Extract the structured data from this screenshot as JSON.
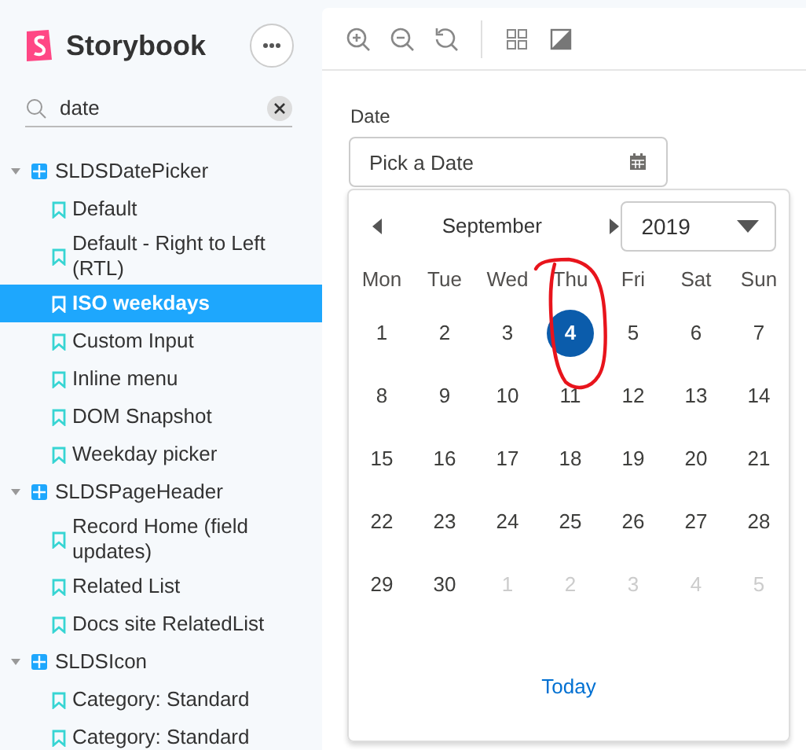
{
  "sidebar": {
    "brand": "Storybook",
    "search": {
      "value": "date"
    },
    "tree": [
      {
        "label": "SLDSDatePicker",
        "expanded": true,
        "children": [
          {
            "label": "Default",
            "selected": false
          },
          {
            "label": "Default - Right to Left (RTL)",
            "selected": false
          },
          {
            "label": "ISO weekdays",
            "selected": true
          },
          {
            "label": "Custom Input",
            "selected": false
          },
          {
            "label": "Inline menu",
            "selected": false
          },
          {
            "label": "DOM Snapshot",
            "selected": false
          },
          {
            "label": "Weekday picker",
            "selected": false
          }
        ]
      },
      {
        "label": "SLDSPageHeader",
        "expanded": true,
        "children": [
          {
            "label": "Record Home (field updates)",
            "selected": false
          },
          {
            "label": "Related List",
            "selected": false
          },
          {
            "label": "Docs site RelatedList",
            "selected": false
          }
        ]
      },
      {
        "label": "SLDSIcon",
        "expanded": true,
        "children": [
          {
            "label": "Category: Standard",
            "selected": false
          },
          {
            "label": "Category: Standard",
            "selected": false
          }
        ]
      }
    ]
  },
  "preview": {
    "field_label": "Date",
    "placeholder": "Pick a Date",
    "calendar": {
      "month": "September",
      "year": "2019",
      "weekdays": [
        "Mon",
        "Tue",
        "Wed",
        "Thu",
        "Fri",
        "Sat",
        "Sun"
      ],
      "weeks": [
        [
          {
            "label": "1",
            "selected": false,
            "outside": false
          },
          {
            "label": "2",
            "selected": false,
            "outside": false
          },
          {
            "label": "3",
            "selected": false,
            "outside": false
          },
          {
            "label": "4",
            "selected": true,
            "outside": false
          },
          {
            "label": "5",
            "selected": false,
            "outside": false
          },
          {
            "label": "6",
            "selected": false,
            "outside": false
          },
          {
            "label": "7",
            "selected": false,
            "outside": false
          }
        ],
        [
          {
            "label": "8",
            "selected": false,
            "outside": false
          },
          {
            "label": "9",
            "selected": false,
            "outside": false
          },
          {
            "label": "10",
            "selected": false,
            "outside": false
          },
          {
            "label": "11",
            "selected": false,
            "outside": false
          },
          {
            "label": "12",
            "selected": false,
            "outside": false
          },
          {
            "label": "13",
            "selected": false,
            "outside": false
          },
          {
            "label": "14",
            "selected": false,
            "outside": false
          }
        ],
        [
          {
            "label": "15",
            "selected": false,
            "outside": false
          },
          {
            "label": "16",
            "selected": false,
            "outside": false
          },
          {
            "label": "17",
            "selected": false,
            "outside": false
          },
          {
            "label": "18",
            "selected": false,
            "outside": false
          },
          {
            "label": "19",
            "selected": false,
            "outside": false
          },
          {
            "label": "20",
            "selected": false,
            "outside": false
          },
          {
            "label": "21",
            "selected": false,
            "outside": false
          }
        ],
        [
          {
            "label": "22",
            "selected": false,
            "outside": false
          },
          {
            "label": "23",
            "selected": false,
            "outside": false
          },
          {
            "label": "24",
            "selected": false,
            "outside": false
          },
          {
            "label": "25",
            "selected": false,
            "outside": false
          },
          {
            "label": "26",
            "selected": false,
            "outside": false
          },
          {
            "label": "27",
            "selected": false,
            "outside": false
          },
          {
            "label": "28",
            "selected": false,
            "outside": false
          }
        ],
        [
          {
            "label": "29",
            "selected": false,
            "outside": false
          },
          {
            "label": "30",
            "selected": false,
            "outside": false
          },
          {
            "label": "1",
            "selected": false,
            "outside": true
          },
          {
            "label": "2",
            "selected": false,
            "outside": true
          },
          {
            "label": "3",
            "selected": false,
            "outside": true
          },
          {
            "label": "4",
            "selected": false,
            "outside": true
          },
          {
            "label": "5",
            "selected": false,
            "outside": true
          }
        ]
      ],
      "today": "Today"
    }
  }
}
